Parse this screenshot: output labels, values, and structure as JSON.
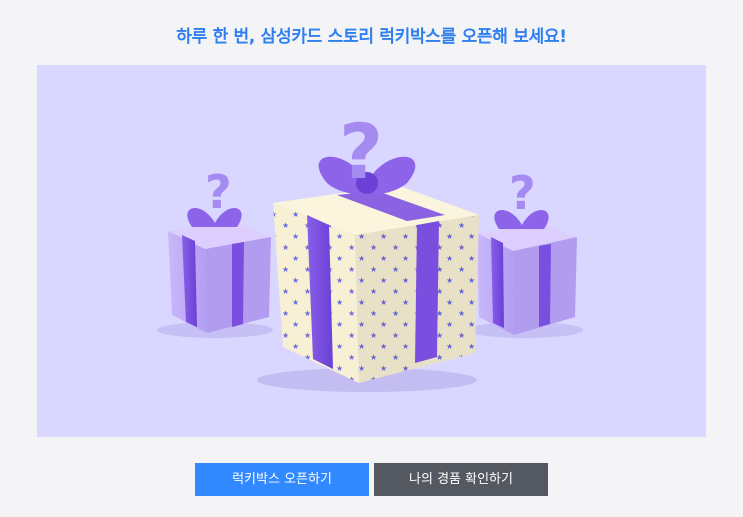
{
  "event": {
    "headline": "하루 한 번, 삼성카드 스토리 럭키박스를 오픈해 보세요!",
    "colors": {
      "headline": "#2e7ff0",
      "stage_background": "#d9d7ff",
      "open_button": "#3289ff",
      "prize_button": "#545860"
    }
  },
  "illustration": {
    "description_icon": "gift-boxes-with-question-marks-icon",
    "box_count": 3
  },
  "actions": {
    "open_label": "럭키박스 오픈하기",
    "prizes_label": "나의 경품 확인하기"
  }
}
